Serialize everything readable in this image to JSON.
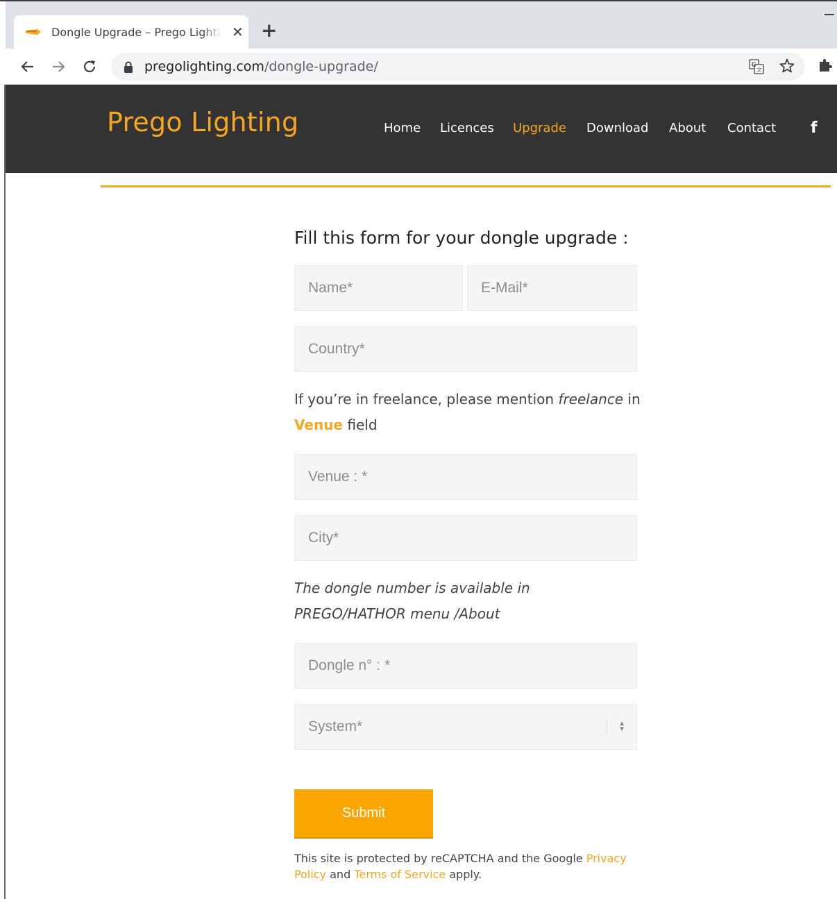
{
  "browser": {
    "tab_title": "Dongle Upgrade – Prego Lighting",
    "url_host": "pregolighting.com",
    "url_path": "/dongle-upgrade/",
    "icons": [
      "back-arrow-icon",
      "forward-arrow-icon",
      "reload-icon",
      "lock-icon",
      "translate-icon",
      "star-icon",
      "extensions-icon"
    ]
  },
  "site": {
    "logo": "Prego Lighting",
    "nav": {
      "home": "Home",
      "licences": "Licences",
      "upgrade": "Upgrade",
      "download": "Download",
      "about": "About",
      "contact": "Contact",
      "facebook": "f"
    },
    "active_nav": "Upgrade"
  },
  "form": {
    "title": "Fill this form for your dongle upgrade :",
    "name_placeholder": "Name*",
    "email_placeholder": "E-Mail*",
    "country_placeholder": "Country*",
    "freelance_note_prefix": "If you’re in freelance, please mention ",
    "freelance_note_emph": "freelance",
    "freelance_note_suffix": " in",
    "venue_link": "Venue",
    "venue_note_suffix": " field",
    "venue_placeholder": "Venue : *",
    "city_placeholder": "City*",
    "dongle_note_line1": "The dongle number is available in",
    "dongle_note_line2": "PREGO/HATHOR menu /About",
    "dongle_placeholder": "Dongle n° : *",
    "system_selected": "System*",
    "submit_label": "Submit"
  },
  "recaptcha": {
    "text1": "This site is protected by reCAPTCHA and the Google ",
    "privacy_a": "Privacy",
    "privacy_b": "Policy",
    "and": " and ",
    "terms": "Terms of Service",
    "apply": " apply."
  },
  "colors": {
    "accent": "#f5a623",
    "header_bg": "#333333",
    "button": "#fba600",
    "field_bg": "#f5f5f5"
  }
}
